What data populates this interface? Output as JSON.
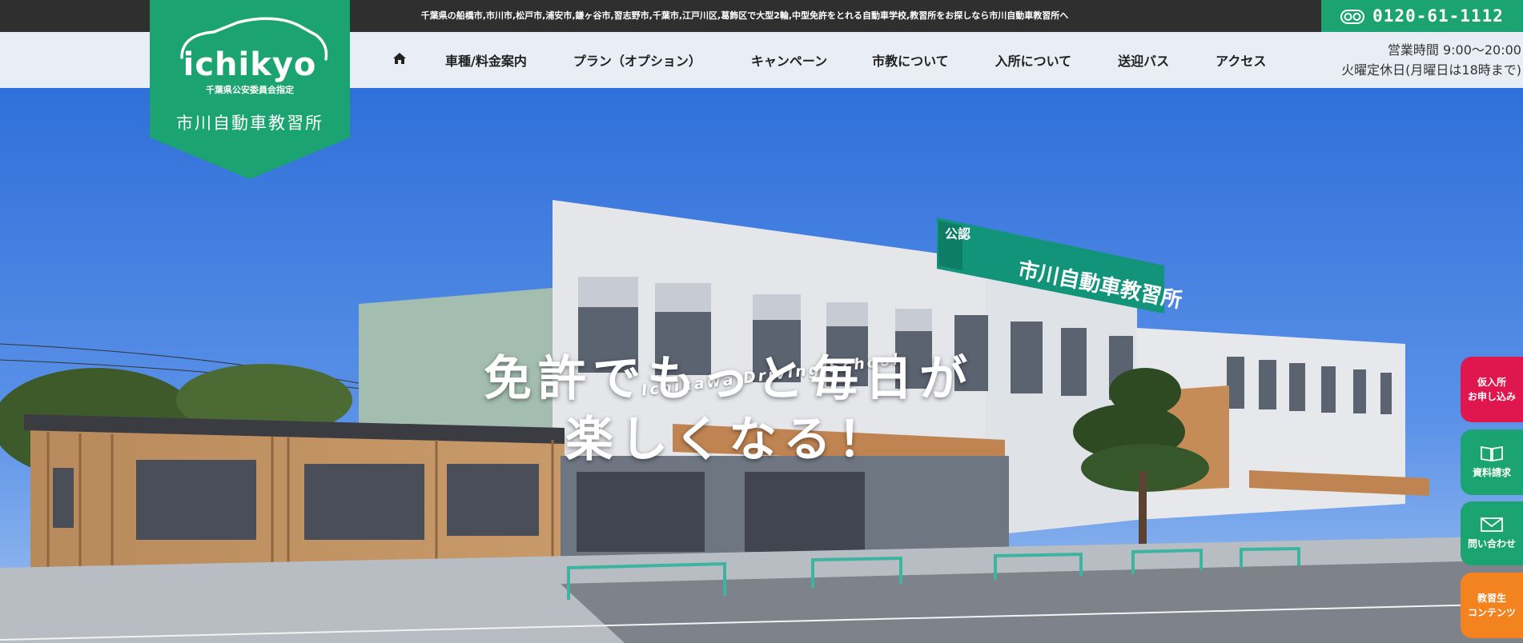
{
  "topbar": {
    "tagline": "千葉県の船橋市,市川市,松戸市,浦安市,鎌ヶ谷市,習志野市,千葉市,江戸川区,葛飾区で大型2輪,中型免許をとれる自動車学校,教習所をお探しなら市川自動車教習所へ",
    "phone_icon": "freedial-icon",
    "phone": "0120-61-1112"
  },
  "logo": {
    "wordmark": "ichikyo",
    "sub": "千葉県公安委員会指定",
    "name": "市川自動車教習所"
  },
  "nav": {
    "items": [
      {
        "label": "車種/料金案内"
      },
      {
        "label": "プラン（オプション）"
      },
      {
        "label": "キャンペーン"
      },
      {
        "label": "市教について"
      },
      {
        "label": "入所について"
      },
      {
        "label": "送迎バス"
      },
      {
        "label": "アクセス"
      }
    ],
    "home_icon": "home-icon"
  },
  "hours": {
    "line1": "営業時間 9:00〜20:00",
    "line2": "火曜定休日(月曜日は18時まで)"
  },
  "hero": {
    "english": "Ichikawa Driving School",
    "line1": "免許でもっと毎日が",
    "line2": "楽しくなる！",
    "sign_small": "公認",
    "sign_name": "市川自動車教習所"
  },
  "side_buttons": {
    "apply": {
      "line1": "仮入所",
      "line2": "お申し込み",
      "color": "#e0174e"
    },
    "docs": {
      "label": "資料請求",
      "icon": "book-icon",
      "color": "#1ba471"
    },
    "contact": {
      "label": "問い合わせ",
      "icon": "mail-icon",
      "color": "#1ba471"
    },
    "students": {
      "line1": "教習生",
      "line2": "コンテンツ",
      "color": "#f2831f"
    }
  },
  "colors": {
    "brand_green": "#1ba471",
    "topbar": "#2f2f30",
    "accent_pink": "#e0174e",
    "accent_orange": "#f2831f"
  }
}
